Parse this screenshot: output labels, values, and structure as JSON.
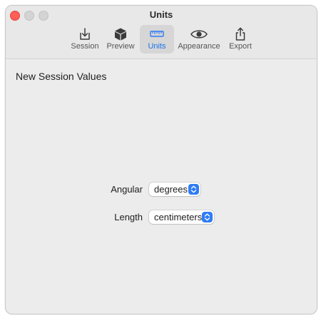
{
  "window": {
    "title": "Units"
  },
  "toolbar": {
    "items": [
      {
        "label": "Session",
        "icon": "download-tray-icon"
      },
      {
        "label": "Preview",
        "icon": "cube-icon"
      },
      {
        "label": "Units",
        "icon": "ruler-icon",
        "selected": true
      },
      {
        "label": "Appearance",
        "icon": "eye-icon"
      },
      {
        "label": "Export",
        "icon": "share-icon"
      }
    ]
  },
  "content": {
    "section_title": "New Session Values",
    "angular": {
      "label": "Angular",
      "value": "degrees"
    },
    "length": {
      "label": "Length",
      "value": "centimeters"
    }
  },
  "colors": {
    "accent": "#2f7cf6",
    "close_button": "#fe5f57",
    "selected_tab_bg": "#d6d6d6",
    "window_bg": "#ececec"
  }
}
